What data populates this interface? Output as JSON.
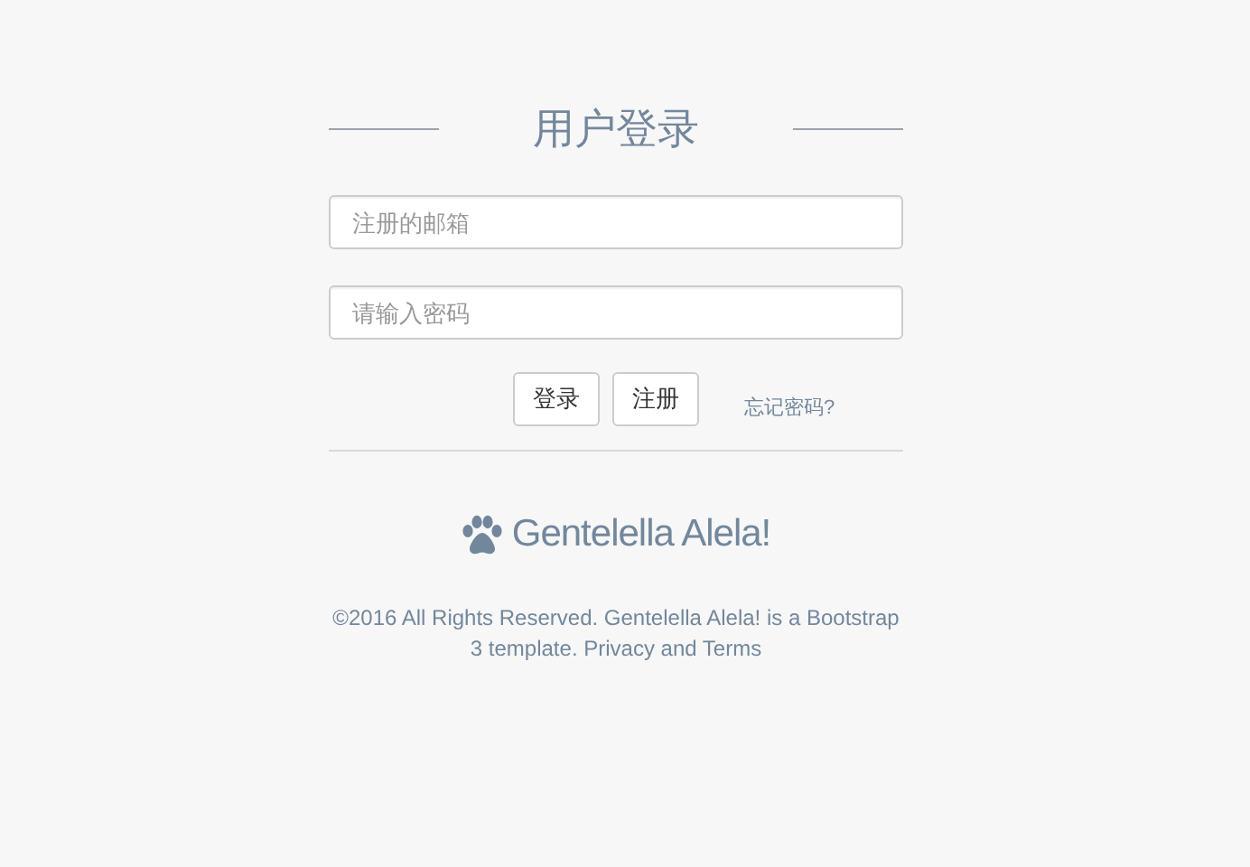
{
  "title": "用户登录",
  "fields": [
    {
      "placeholder": "注册的邮箱"
    },
    {
      "placeholder": "请输入密码"
    }
  ],
  "buttons": [
    "登录",
    "注册"
  ],
  "forgot_link": "忘记密码?",
  "brand": "Gentelella Alela!",
  "copyright": "©2016 All Rights Reserved. Gentelella Alela! is a Bootstrap 3 template. Privacy and Terms"
}
